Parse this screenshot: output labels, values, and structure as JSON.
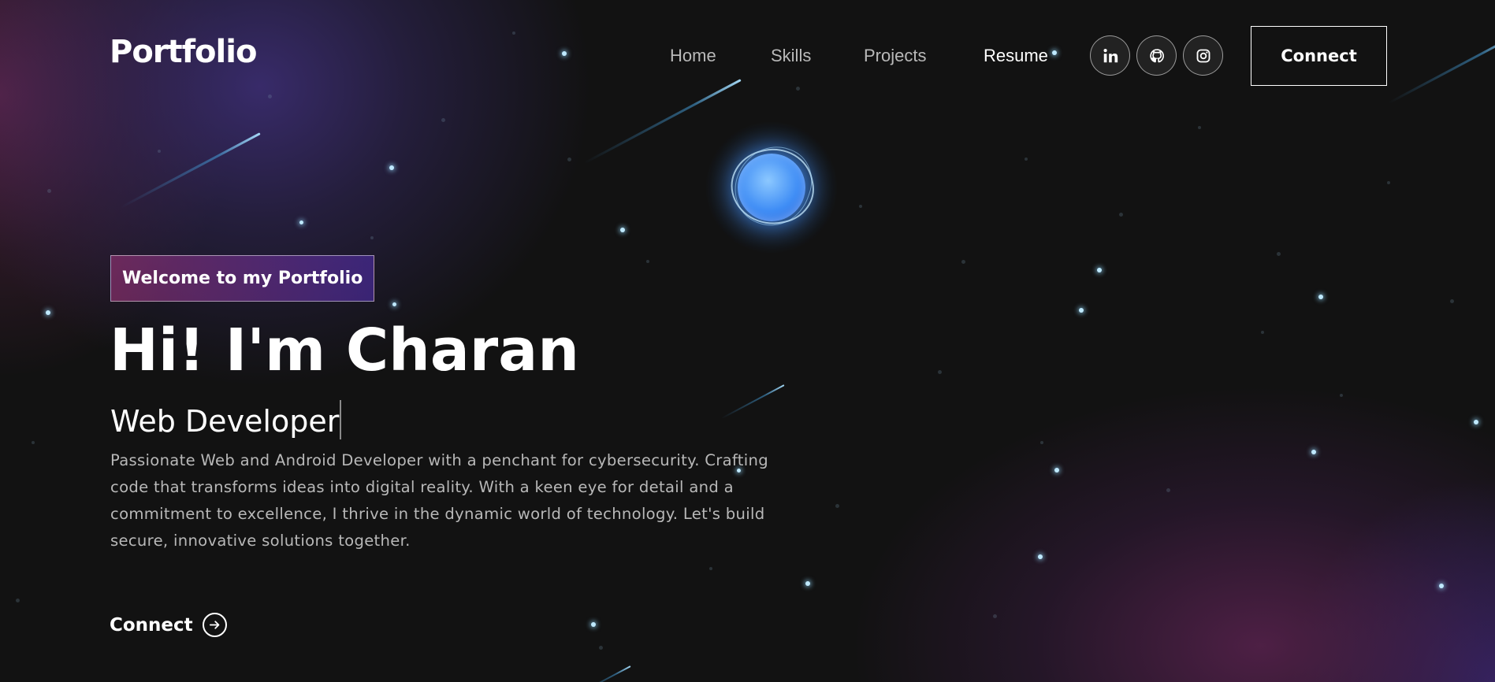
{
  "navbar": {
    "brand": "Portfolio",
    "links": [
      {
        "label": "Home"
      },
      {
        "label": "Skills"
      },
      {
        "label": "Projects"
      },
      {
        "label": "Resume"
      }
    ],
    "socials": [
      {
        "icon": "linkedin-icon"
      },
      {
        "icon": "github-icon"
      },
      {
        "icon": "instagram-icon"
      }
    ],
    "connect_label": "Connect"
  },
  "hero": {
    "tagline": "Welcome to my Portfolio",
    "title": "Hi! I'm Charan",
    "role": "Web Developer",
    "description": "Passionate Web and Android Developer with a penchant for cybersecurity. Crafting code that transforms ideas into digital reality. With a keen eye for detail and a commitment to excellence, I thrive in the dynamic world of technology. Let's build secure, innovative solutions together.",
    "connect_label": "Connect",
    "connect_icon": "arrow-right-circle-icon"
  },
  "colors": {
    "background": "#121212",
    "tagline_gradient_start": "#AA367C",
    "tagline_gradient_end": "#4A2FBD",
    "planet": "#3F8DF5",
    "star": "#BFE9FF"
  }
}
